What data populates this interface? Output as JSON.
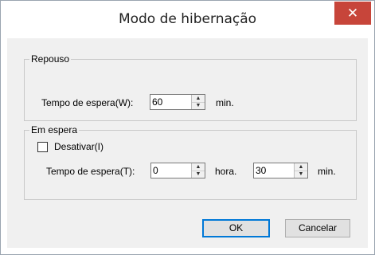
{
  "window": {
    "title": "Modo de hibernação",
    "close_glyph": "✕"
  },
  "repouso": {
    "legend": "Repouso",
    "wait_label": "Tempo de espera(W):",
    "wait_value": "60",
    "wait_unit": "min."
  },
  "em_espera": {
    "legend": "Em espera",
    "disable_label": "Desativar(I)",
    "disable_checked": false,
    "wait_label": "Tempo de espera(T):",
    "hours_value": "0",
    "hours_unit": "hora.",
    "minutes_value": "30",
    "minutes_unit": "min."
  },
  "buttons": {
    "ok": "OK",
    "cancel": "Cancelar"
  },
  "icons": {
    "spin_up": "▲",
    "spin_down": "▼"
  }
}
